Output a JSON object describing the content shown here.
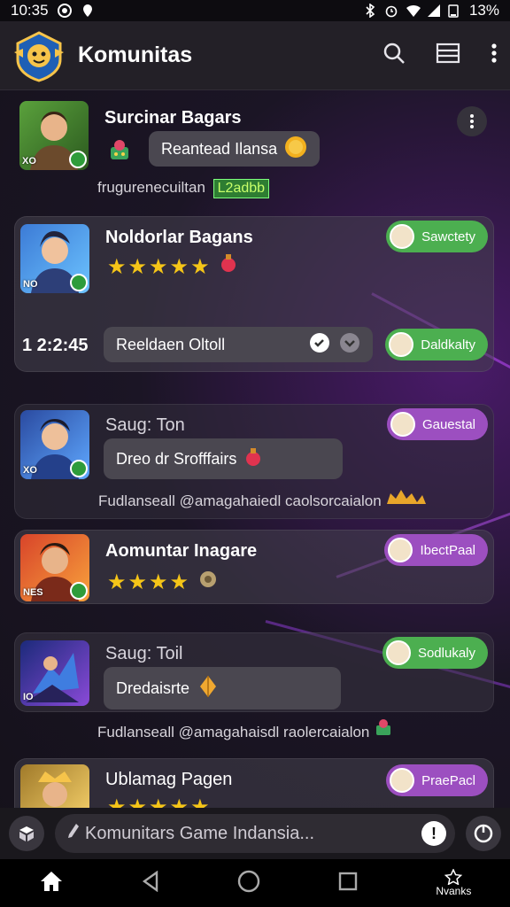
{
  "status": {
    "time": "10:35",
    "battery": "13%"
  },
  "header": {
    "title": "Komunitas"
  },
  "posts": [
    {
      "name": "Surcinar Bagars",
      "message": "Reantead Ilansa",
      "footer": "frugurenecuiltan",
      "footer_tag": "L2adbb",
      "avatar_tag": "XO"
    },
    {
      "name": "Noldorlar Bagans",
      "stars": "★★★★★",
      "chip": "Sawctety",
      "time": "1 2:2:45",
      "message": "Reeldaen Oltoll",
      "chip2": "Daldkalty",
      "avatar_tag": "NO"
    },
    {
      "name": "Saug: Ton",
      "chip": "Gauestal",
      "message": "Dreo dr Srofffairs",
      "footer": "Fudlanseall @amagahaiedl caolsorcaialon",
      "avatar_tag": "XO"
    },
    {
      "name": "Aomuntar Inagare",
      "stars": "★★★★",
      "chip": "IbectPaal",
      "avatar_tag": "NES"
    },
    {
      "name": "Saug: Toil",
      "chip": "Sodlukaly",
      "message": "Dredaisrte",
      "footer": "Fudlanseall @amagahaisdl raolercaialon",
      "avatar_tag": "IO"
    },
    {
      "name": "Ublamag Pagen",
      "chip": "PraePacl",
      "stars": "★★★★★"
    }
  ],
  "composer": {
    "placeholder": "Komunitars Game Indansia..."
  },
  "nav": {
    "extra_label": "Nvanks"
  },
  "colors": {
    "accent_green": "#4caf50",
    "accent_purple": "#9c4fc0",
    "header_bg": "#232027"
  }
}
